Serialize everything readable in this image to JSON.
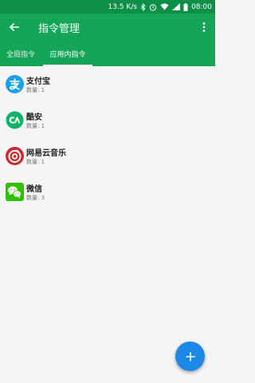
{
  "status_bar": {
    "network_speed": "13.5 K/s",
    "time": "08:00",
    "icons": [
      "bluetooth-icon",
      "alarm-icon",
      "wifi-icon",
      "signal-icon",
      "battery-icon"
    ]
  },
  "app_bar": {
    "title": "指令管理",
    "back_icon": "arrow-left-icon",
    "more_icon": "more-vertical-icon"
  },
  "tabs": [
    {
      "label": "全局指令",
      "selected": false
    },
    {
      "label": "应用内指令",
      "selected": true
    }
  ],
  "apps": [
    {
      "name": "支付宝",
      "count": "数量: 1",
      "icon": "alipay-icon"
    },
    {
      "name": "酷安",
      "count": "数量: 1",
      "icon": "coolapk-icon"
    },
    {
      "name": "网易云音乐",
      "count": "数量: 1",
      "icon": "netease-music-icon"
    },
    {
      "name": "微信",
      "count": "数量: 3",
      "icon": "wechat-icon"
    }
  ],
  "fab": {
    "icon": "plus-icon"
  },
  "colors": {
    "status_bar": "#0e8f47",
    "app_bar": "#14a557",
    "fab": "#1e88e5",
    "background": "#f5f5f5"
  }
}
